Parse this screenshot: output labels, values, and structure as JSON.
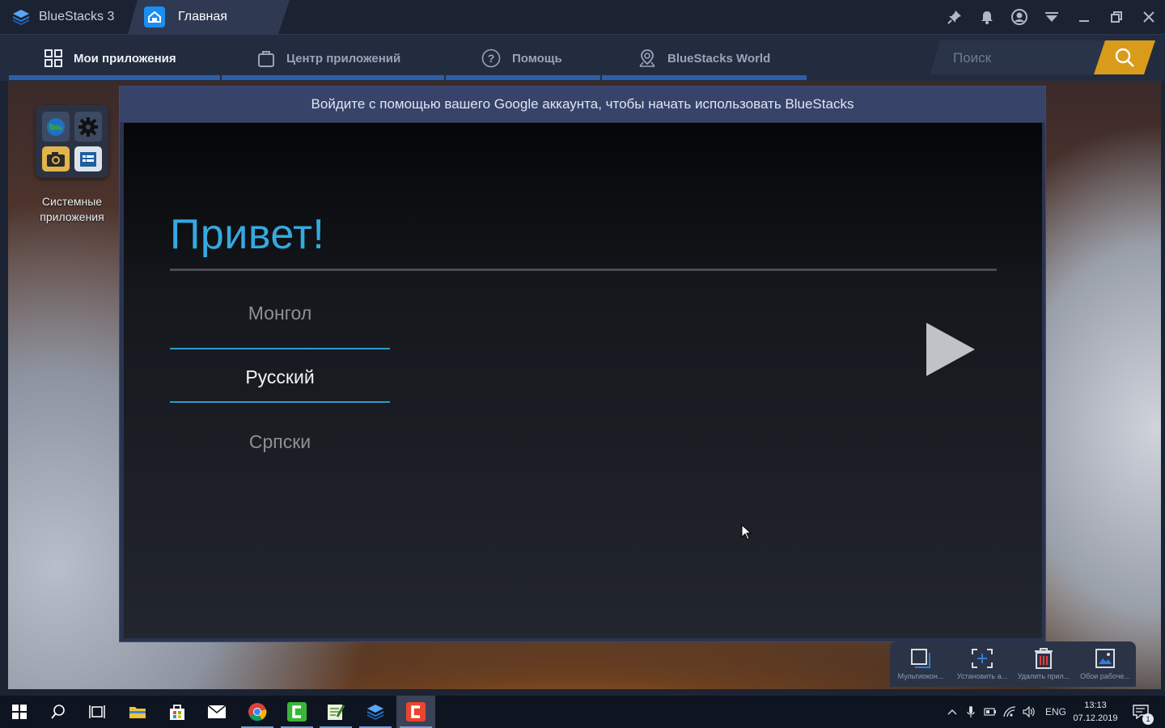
{
  "titlebar": {
    "app_name": "BlueStacks 3",
    "home_tab": "Главная",
    "icons": [
      "pin-icon",
      "bell-icon",
      "account-icon",
      "menu-down-icon",
      "minimize-icon",
      "restore-icon",
      "close-icon"
    ]
  },
  "nav": {
    "items": [
      {
        "label": "Мои приложения",
        "icon": "grid-icon"
      },
      {
        "label": "Центр приложений",
        "icon": "bag-icon"
      },
      {
        "label": "Помощь",
        "icon": "help-icon"
      },
      {
        "label": "BlueStacks World",
        "icon": "map-pin-icon"
      }
    ],
    "search_placeholder": "Поиск"
  },
  "desktop": {
    "system_apps_label": "Системные приложения"
  },
  "dialog": {
    "header": "Войдите с помощью вашего Google аккаунта, чтобы начать использовать BlueStacks",
    "greeting": "Привет!",
    "languages": [
      "Монгол",
      "Русский",
      "Српски"
    ],
    "selected_language": "Русский"
  },
  "bottom_tools": [
    {
      "label": "Мультиокон...",
      "icon": "multi-instance-icon"
    },
    {
      "label": "Установить а...",
      "icon": "install-apk-icon"
    },
    {
      "label": "Удалить прил...",
      "icon": "delete-app-icon"
    },
    {
      "label": "Обои рабоче...",
      "icon": "wallpaper-icon"
    }
  ],
  "taskbar": {
    "apps": [
      "start-icon",
      "search-icon",
      "task-view-icon",
      "file-explorer-icon",
      "store-icon",
      "mail-icon",
      "chrome-icon",
      "camtasia-icon",
      "notepad-icon",
      "bluestacks-icon",
      "camtasia-recorder-icon"
    ],
    "language": "ENG",
    "time": "13:13",
    "date": "07.12.2019",
    "notification_count": "1"
  },
  "colors": {
    "accent_blue": "#36a9e0",
    "search_button": "#d89b1a",
    "nav_underline": "#2d5ea8"
  }
}
